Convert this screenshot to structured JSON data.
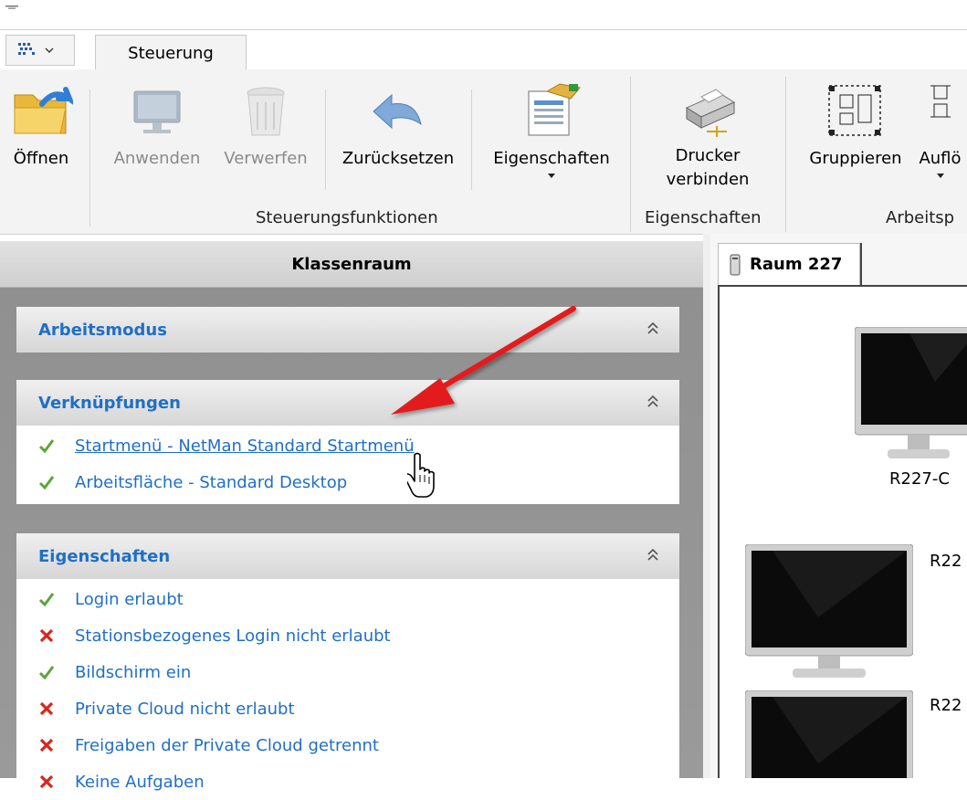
{
  "quick_access": {
    "icon": "grid-icon",
    "chevron": "chevron-down-icon"
  },
  "tabs": [
    {
      "label": "Steuerung",
      "active": true
    }
  ],
  "ribbon": {
    "buttons": {
      "open": "Öffnen",
      "apply": "Anwenden",
      "discard": "Verwerfen",
      "reset": "Zurücksetzen",
      "properties": "Eigenschaften",
      "printer_line1": "Drucker",
      "printer_line2": "verbinden",
      "group": "Gruppieren",
      "resolve": "Auflö"
    },
    "groups": {
      "control": "Steuerungsfunktionen",
      "properties": "Eigenschaften",
      "workspace": "Arbeitsp"
    }
  },
  "left_panel": {
    "title": "Klassenraum",
    "sections": [
      {
        "title": "Arbeitsmodus",
        "items": []
      },
      {
        "title": "Verknüpfungen",
        "items": [
          {
            "status": "ok",
            "text": "Startmenü - NetMan Standard Startmenü",
            "hovered": true
          },
          {
            "status": "ok",
            "text": "Arbeitsfläche - Standard Desktop"
          }
        ]
      },
      {
        "title": "Eigenschaften",
        "items": [
          {
            "status": "ok",
            "text": "Login erlaubt"
          },
          {
            "status": "error",
            "text": "Stationsbezogenes Login nicht erlaubt"
          },
          {
            "status": "ok",
            "text": "Bildschirm ein"
          },
          {
            "status": "error",
            "text": "Private Cloud nicht erlaubt"
          },
          {
            "status": "error",
            "text": "Freigaben der Private Cloud getrennt"
          },
          {
            "status": "error",
            "text": "Keine Aufgaben"
          }
        ]
      }
    ]
  },
  "room": {
    "tab_label": "Raum 227",
    "computers": [
      {
        "label": "R227-C"
      },
      {
        "label": "R22"
      },
      {
        "label": "R22"
      }
    ]
  },
  "colors": {
    "link": "#1f6fc6",
    "ok": "#5aa53a",
    "error": "#d9261c",
    "arrow": "#e21f1f"
  }
}
